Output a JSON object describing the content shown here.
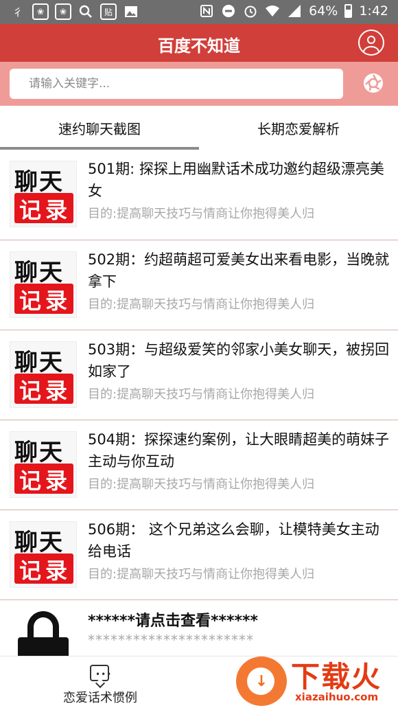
{
  "status_bar": {
    "left_icons": [
      "signal-char-icon",
      "baidu-paw-icon",
      "baidu-paw-icon",
      "search-icon",
      "paste-icon",
      "image-icon"
    ],
    "paste_label": "贴",
    "left_char": "彳",
    "battery_percent": "64%",
    "time": "1:42",
    "network_label": "4G"
  },
  "header": {
    "title": "百度不知道"
  },
  "search": {
    "placeholder": "请输入关键字..."
  },
  "tabs": [
    {
      "label": "速约聊天截图",
      "active": true
    },
    {
      "label": "长期恋爱解析",
      "active": false
    }
  ],
  "thumbnail": {
    "line1": "聊天",
    "line2": "记录"
  },
  "items": [
    {
      "title": "501期: 探探上用幽默话术成功邀约超级漂亮美女",
      "subtitle": "目的:提高聊天技巧与情商让你抱得美人归"
    },
    {
      "title": "502期：约超萌超可爱美女出来看电影，当晚就拿下",
      "subtitle": "目的:提高聊天技巧与情商让你抱得美人归"
    },
    {
      "title": "503期：与超级爱笑的邻家小美女聊天，被拐回如家了",
      "subtitle": "目的:提高聊天技巧与情商让你抱得美人归"
    },
    {
      "title": "504期：探探速约案例，让大眼睛超美的萌妹子主动与你互动",
      "subtitle": "目的:提高聊天技巧与情商让你抱得美人归"
    },
    {
      "title": "506期： 这个兄弟这么会聊，让模特美女主动给电话",
      "subtitle": "目的:提高聊天技巧与情商让你抱得美人归"
    }
  ],
  "locked_item": {
    "title": "******请点击查看******",
    "subtitle": "**********************"
  },
  "bottom_nav": {
    "label": "恋爱话术惯例"
  },
  "watermark": {
    "text": "下载火",
    "url": "xiazaihuo.com"
  },
  "colors": {
    "header": "#d13f3a",
    "search_bg": "#ef9c98",
    "status_bar": "#6e6e6e",
    "subtitle": "#a8a8a8"
  }
}
